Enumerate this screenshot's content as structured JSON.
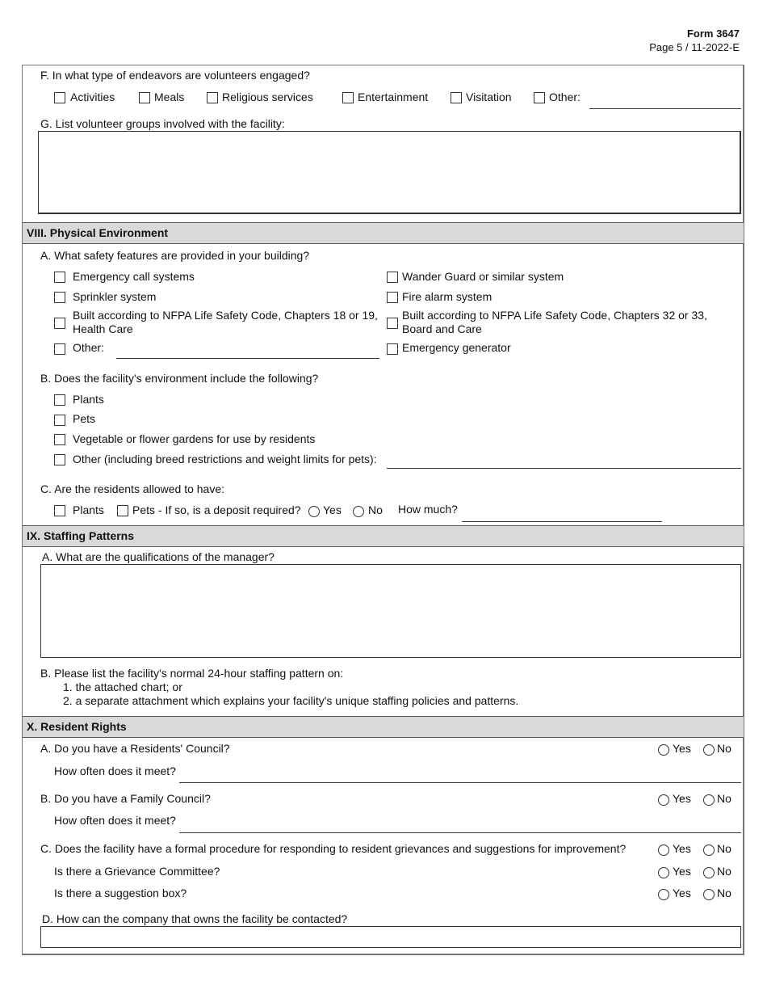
{
  "header": {
    "form_number": "Form 3647",
    "page_info": "Page 5 / 11-2022-E"
  },
  "section_vii_cont": {
    "f_question": "F. In what type of endeavors are volunteers engaged?",
    "f_options": [
      "Activities",
      "Meals",
      "Religious services",
      "Entertainment",
      "Visitation",
      "Other:"
    ],
    "f_other_value": "",
    "g_question": "G. List volunteer groups involved with the facility:",
    "g_value": ""
  },
  "section_viii": {
    "title": "VIII. Physical Environment",
    "a_question": "A. What safety features are provided in your building?",
    "a_left": [
      "Emergency call systems",
      "Sprinkler system",
      "Built according to NFPA Life Safety Code, Chapters 18 or 19,",
      "Other:"
    ],
    "a_left_nfpa_line2": "Health Care",
    "a_right": [
      "Wander Guard or similar system",
      "Fire alarm system",
      "Built according to NFPA Life Safety Code, Chapters 32 or 33,",
      "Emergency generator"
    ],
    "a_right_nfpa_line2": "Board and Care",
    "a_other_value": "",
    "b_question": "B. Does the facility's environment include the following?",
    "b_options": [
      "Plants",
      "Pets",
      "Vegetable or flower gardens for use by residents",
      "Other (including breed restrictions and weight limits for pets):"
    ],
    "b_other_value": "",
    "c_question": "C. Are the residents allowed to have:",
    "c_plants": "Plants",
    "c_pets": "Pets - If so, is a deposit required?",
    "c_yes": "Yes",
    "c_no": "No",
    "c_how_much": "How much?",
    "c_how_much_value": ""
  },
  "section_ix": {
    "title": "IX. Staffing Patterns",
    "a_question": "A. What are the qualifications of the manager?",
    "a_value": "",
    "b_question": "B. Please list the facility's normal 24-hour staffing pattern on:",
    "b_items": [
      "1. the attached chart; or",
      "2. a separate attachment which explains your facility's unique staffing policies and patterns."
    ]
  },
  "section_x": {
    "title": "X. Resident Rights",
    "a_question": "A. Do you have a Residents' Council?",
    "a_often": "How often does it meet?",
    "b_question": "B. Do you have a Family Council?",
    "b_often": "How often does it meet?",
    "c_question": "C. Does the facility have a formal procedure for responding to resident grievances and suggestions for improvement?",
    "c_committee": "Is there a Grievance Committee?",
    "c_box": "Is there a suggestion box?",
    "d_question": "D. How can the company that owns the facility be contacted?",
    "d_value": "",
    "yes": "Yes",
    "no": "No"
  }
}
